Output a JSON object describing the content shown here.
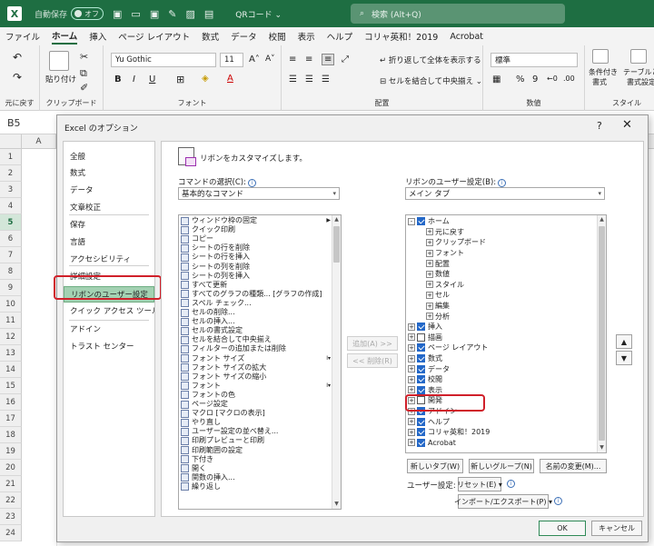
{
  "titlebar": {
    "autosave_label": "自動保存",
    "autosave_state": "オフ",
    "file_name": "QRコード",
    "search_placeholder": "検索 (Alt+Q)"
  },
  "menu": [
    "ファイル",
    "ホーム",
    "挿入",
    "ページ レイアウト",
    "数式",
    "データ",
    "校閲",
    "表示",
    "ヘルプ",
    "コリャ英和！2019",
    "Acrobat"
  ],
  "menu_active_index": 1,
  "ribbon": {
    "undo_label": "元に戻す",
    "paste_label": "貼り付け",
    "clipboard_label": "クリップボード",
    "font_name": "Yu Gothic",
    "font_size": "11",
    "font_group": "フォント",
    "wrap_text": "折り返して全体を表示する",
    "merge_center": "セルを結合して中央揃え",
    "alignment_group": "配置",
    "number_format": "標準",
    "number_group": "数値",
    "cond_format": "条件付き",
    "cond_format2": "書式",
    "table_format": "テーブルとして",
    "table_format2": "書式設定",
    "style_group": "スタイル"
  },
  "namebox": "B5",
  "column_a": "A",
  "rows": [
    "1",
    "2",
    "3",
    "4",
    "5",
    "6",
    "7",
    "8",
    "9",
    "10",
    "11",
    "12",
    "13",
    "14",
    "15",
    "16",
    "17",
    "18",
    "19",
    "20",
    "21",
    "22",
    "23",
    "24"
  ],
  "selected_row": "5",
  "dialog": {
    "title": "Excel のオプション",
    "help": "?",
    "close": "✕",
    "nav": [
      "全般",
      "数式",
      "データ",
      "文章校正",
      "保存",
      "言語",
      "アクセシビリティ",
      "詳細設定",
      "リボンのユーザー設定",
      "クイック アクセス ツール バー",
      "アドイン",
      "トラスト センター"
    ],
    "nav_selected_index": 8,
    "header": "リボンをカスタマイズします。",
    "commands_label": "コマンドの選択(C):",
    "commands_select": "基本的なコマンド",
    "ribbon_label": "リボンのユーザー設定(B):",
    "ribbon_select": "メイン タブ",
    "commands": [
      "ウィンドウ枠の固定",
      "クイック印刷",
      "コピー",
      "シートの行を削除",
      "シートの行を挿入",
      "シートの列を削除",
      "シートの列を挿入",
      "すべて更新",
      "すべてのグラフの種類... [グラフの作成]",
      "スペル チェック...",
      "セルの削除...",
      "セルの挿入...",
      "セルの書式設定",
      "セルを結合して中央揃え",
      "フィルターの追加または削除",
      "フォント サイズ",
      "フォント サイズの拡大",
      "フォント サイズの縮小",
      "フォント",
      "フォントの色",
      "ページ設定",
      "マクロ [マクロの表示]",
      "やり直し",
      "ユーザー設定の並べ替え...",
      "印刷プレビューと印刷",
      "印刷範囲の設定",
      "下付き",
      "開く",
      "関数の挿入...",
      "繰り返し"
    ],
    "add_button": "追加(A) >>",
    "remove_button": "<< 削除(R)",
    "home_tab": "ホーム",
    "home_groups": [
      "元に戻す",
      "クリップボード",
      "フォント",
      "配置",
      "数値",
      "スタイル",
      "セル",
      "編集",
      "分析"
    ],
    "tabs": [
      {
        "label": "挿入",
        "checked": true
      },
      {
        "label": "描画",
        "checked": false
      },
      {
        "label": "ページ レイアウト",
        "checked": true
      },
      {
        "label": "数式",
        "checked": true
      },
      {
        "label": "データ",
        "checked": true
      },
      {
        "label": "校閲",
        "checked": true
      },
      {
        "label": "表示",
        "checked": true
      },
      {
        "label": "開発",
        "checked": false
      },
      {
        "label": "アドイン",
        "checked": true
      },
      {
        "label": "ヘルプ",
        "checked": true
      },
      {
        "label": "コリャ英和！2019",
        "checked": true
      },
      {
        "label": "Acrobat",
        "checked": true
      }
    ],
    "new_tab_button": "新しいタブ(W)",
    "new_group_button": "新しいグループ(N)",
    "rename_button": "名前の変更(M)...",
    "custom_label": "ユーザー設定:",
    "reset_button": "リセット(E) ▾",
    "import_export_button": "インポート/エクスポート(P) ▾",
    "ok_button": "OK",
    "cancel_button": "キャンセル"
  },
  "colors": {
    "excel_green": "#1e6e42",
    "highlight_red": "#d0202a",
    "nav_selected": "#a3d1b2",
    "checkbox_blue": "#2468c8"
  }
}
